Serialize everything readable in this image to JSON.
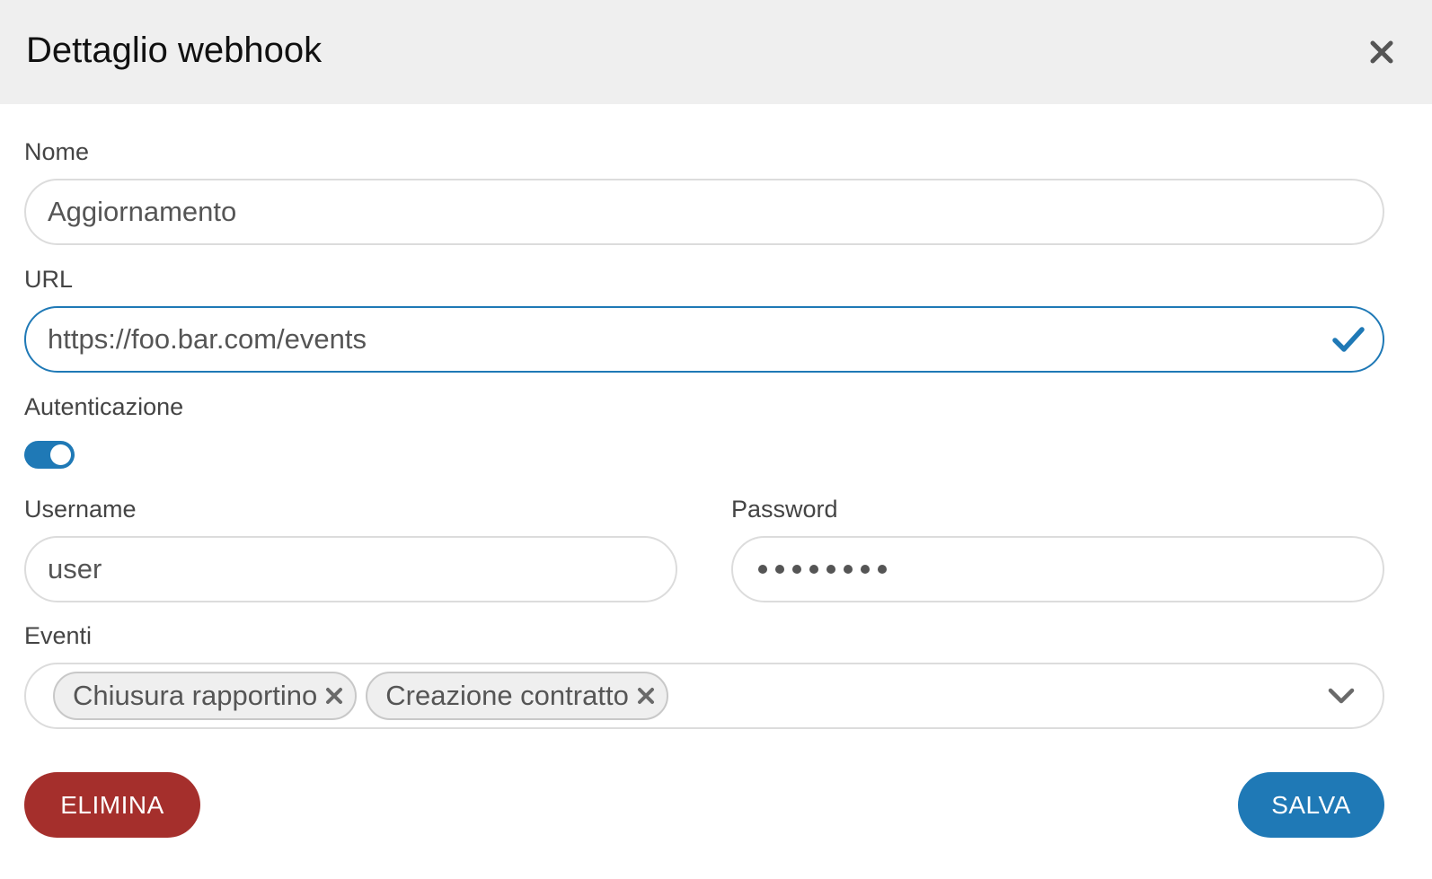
{
  "dialog": {
    "title": "Dettaglio webhook",
    "close_icon": "close-icon"
  },
  "fields": {
    "name": {
      "label": "Nome",
      "value": "Aggiornamento"
    },
    "url": {
      "label": "URL",
      "value": "https://foo.bar.com/events",
      "valid_icon": "check-icon"
    },
    "auth": {
      "label": "Autenticazione",
      "enabled": true
    },
    "username": {
      "label": "Username",
      "value": "user"
    },
    "password": {
      "label": "Password",
      "masked_length": 8
    },
    "events": {
      "label": "Eventi",
      "selected": [
        "Chiusura rapportino",
        "Creazione contratto"
      ],
      "remove_icon": "close-icon",
      "dropdown_icon": "chevron-down-icon"
    }
  },
  "actions": {
    "delete_label": "ELIMINA",
    "save_label": "SALVA"
  },
  "colors": {
    "header_bg": "#efefef",
    "accent": "#1f79b6",
    "danger": "#a52f2c",
    "border": "#dcdcdc"
  }
}
